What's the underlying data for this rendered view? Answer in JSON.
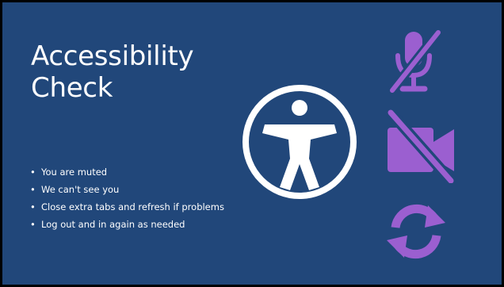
{
  "slide": {
    "title_lines": [
      "Accessibility",
      "Check"
    ],
    "bullet_char": "•",
    "bullets": [
      "You are muted",
      "We can't see you",
      "Close extra tabs and refresh if problems",
      "Log out and in again as needed"
    ]
  },
  "icons": {
    "accessibility": "accessibility-icon",
    "microphone": "microphone-muted-icon",
    "video": "video-off-icon",
    "refresh": "refresh-icon"
  },
  "colors": {
    "background": "#21477a",
    "text": "#ffffff",
    "accent": "#9b5fd0"
  }
}
